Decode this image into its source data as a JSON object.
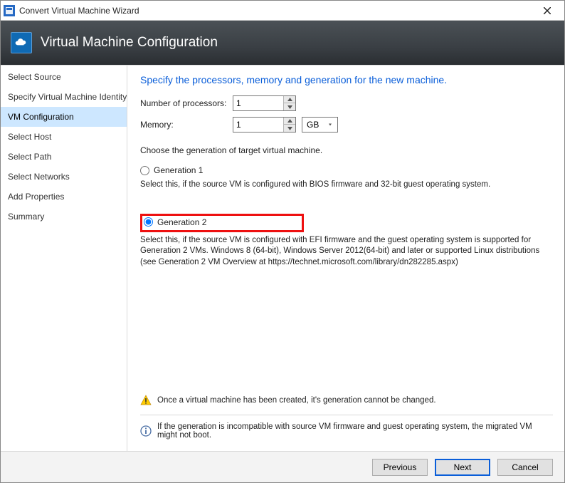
{
  "window": {
    "title": "Convert Virtual Machine Wizard"
  },
  "banner": {
    "title": "Virtual Machine Configuration"
  },
  "sidebar": {
    "items": [
      {
        "label": "Select Source"
      },
      {
        "label": "Specify Virtual Machine Identity"
      },
      {
        "label": "VM Configuration"
      },
      {
        "label": "Select Host"
      },
      {
        "label": "Select Path"
      },
      {
        "label": "Select Networks"
      },
      {
        "label": "Add Properties"
      },
      {
        "label": "Summary"
      }
    ],
    "selected_index": 2
  },
  "main": {
    "heading": "Specify the processors, memory and generation for the new machine.",
    "proc_label": "Number of processors:",
    "proc_value": "1",
    "mem_label": "Memory:",
    "mem_value": "1",
    "mem_unit": "GB",
    "gen_prompt": "Choose the generation of target virtual machine.",
    "gen1": {
      "label": "Generation 1",
      "note": "Select this, if the source VM is configured with BIOS firmware and 32-bit guest operating system.",
      "checked": false
    },
    "gen2": {
      "label": "Generation 2",
      "note": "Select this, if the source VM is configured with EFI firmware and the guest operating system is supported for Generation 2 VMs. Windows 8 (64-bit), Windows Server 2012(64-bit) and later or supported Linux distributions (see Generation 2 VM Overview at https://technet.microsoft.com/library/dn282285.aspx)",
      "checked": true
    },
    "warn_text": "Once a virtual machine has been created, it's generation cannot be changed.",
    "info_text": "If the generation is incompatible with source VM firmware and guest operating system, the migrated VM might not boot."
  },
  "footer": {
    "previous": "Previous",
    "next": "Next",
    "cancel": "Cancel"
  }
}
